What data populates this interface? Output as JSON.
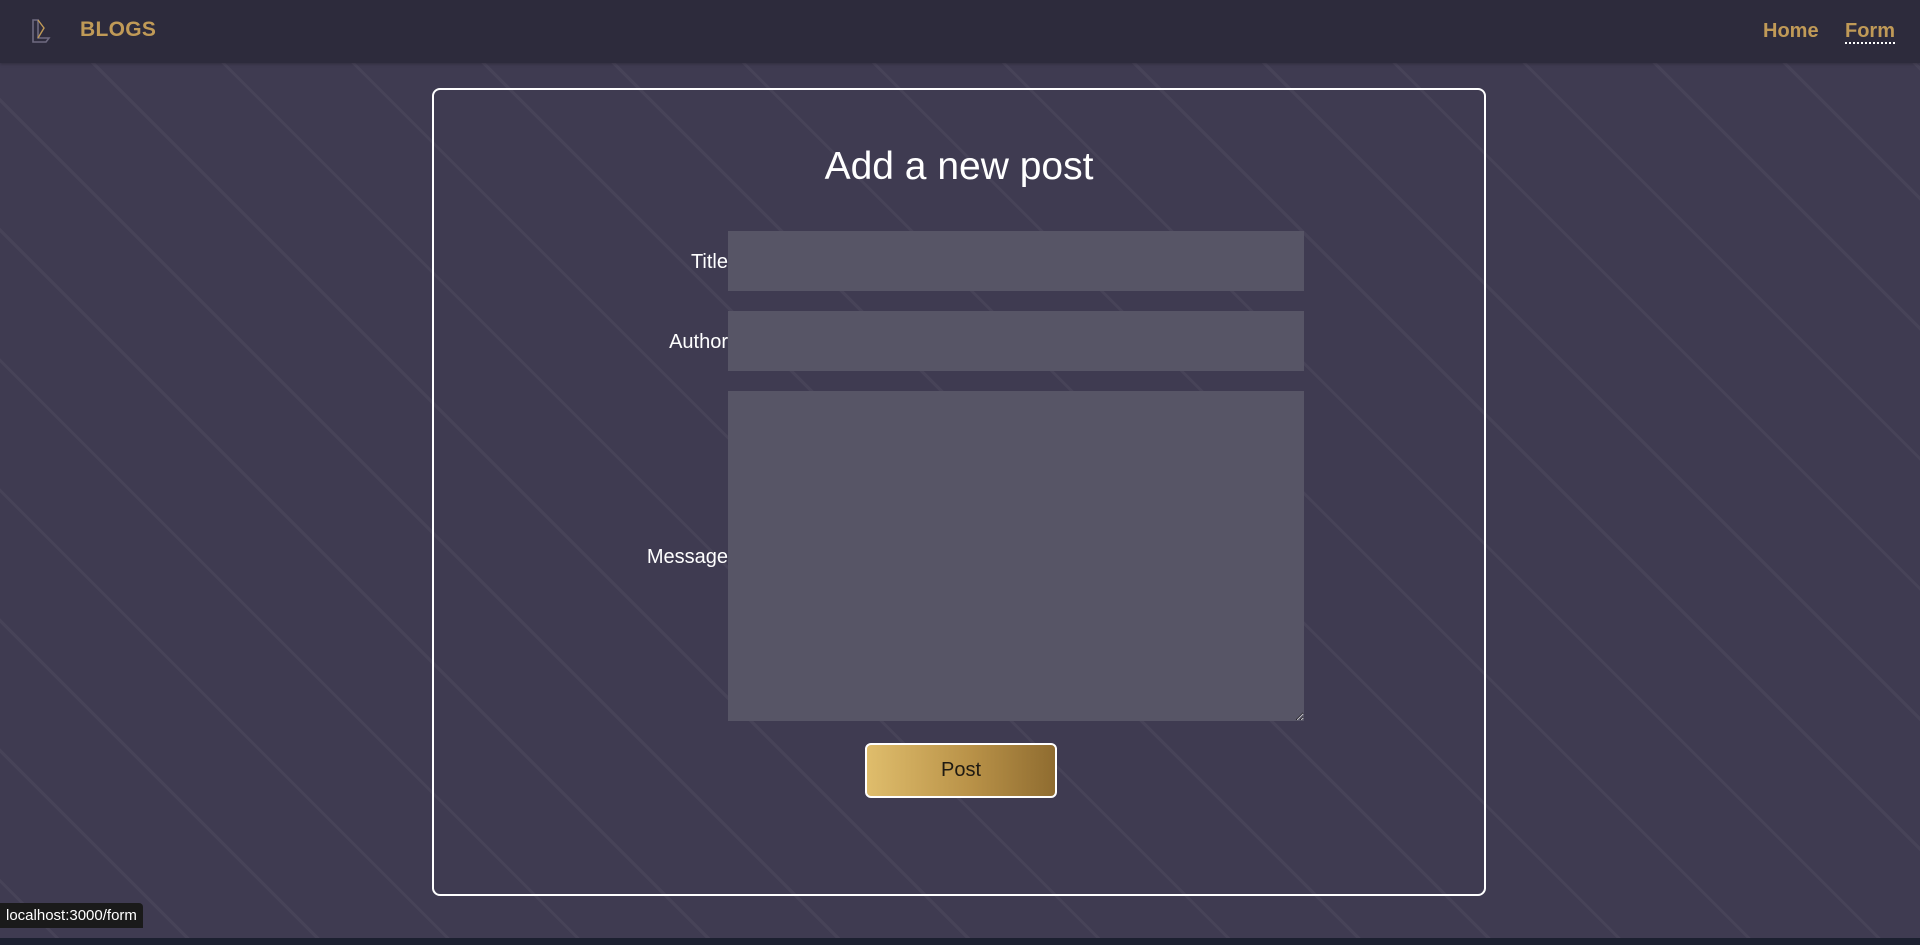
{
  "navbar": {
    "brand": "BLOGS",
    "links": [
      {
        "label": "Home"
      },
      {
        "label": "Form"
      }
    ]
  },
  "form": {
    "heading": "Add a new post",
    "fields": {
      "title": {
        "label": "Title",
        "value": ""
      },
      "author": {
        "label": "Author",
        "value": ""
      },
      "message": {
        "label": "Message",
        "value": ""
      }
    },
    "submit_label": "Post"
  },
  "status_bar": {
    "url": "localhost:3000/form"
  },
  "colors": {
    "accent": "#c09a57",
    "background": "#3f3b51",
    "navbar": "#2d2b3c",
    "input": "#575566"
  },
  "icons": {
    "logo": "book-logo-icon"
  }
}
